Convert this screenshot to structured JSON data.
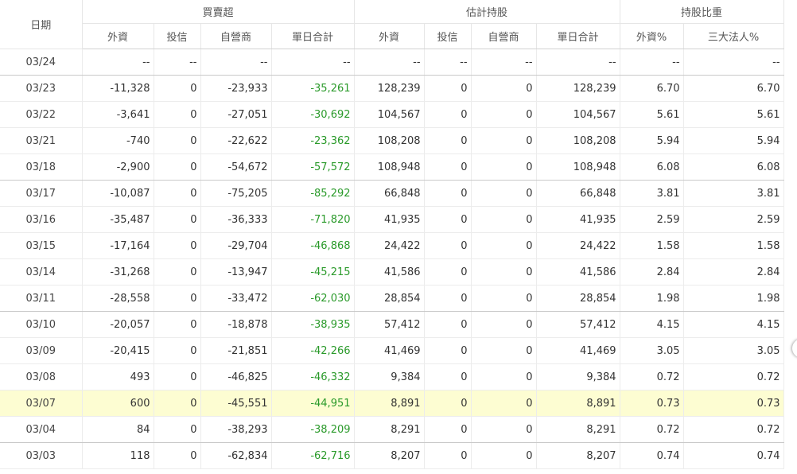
{
  "header": {
    "date_label": "日期",
    "group_trade": "買賣超",
    "group_holdings": "估計持股",
    "group_ratio": "持股比重",
    "col_foreign": "外資",
    "col_trust": "投信",
    "col_dealer": "自營商",
    "col_daily_total": "單日合計",
    "col_foreign_h": "外資",
    "col_trust_h": "投信",
    "col_dealer_h": "自營商",
    "col_daily_total_h": "單日合計",
    "col_foreign_pct": "外資%",
    "col_big3_pct": "三大法人%"
  },
  "colors": {
    "total_positive_green": "#2a9a2a",
    "highlight_row": "#fdfdd2"
  },
  "rows": [
    {
      "date": "03/24",
      "foreign": "--",
      "trust": "--",
      "dealer": "--",
      "total": "--",
      "h_foreign": "--",
      "h_trust": "--",
      "h_dealer": "--",
      "h_total": "--",
      "foreign_pct": "--",
      "big3_pct": "--"
    },
    {
      "date": "03/23",
      "foreign": "-11,328",
      "trust": "0",
      "dealer": "-23,933",
      "total": "-35,261",
      "h_foreign": "128,239",
      "h_trust": "0",
      "h_dealer": "0",
      "h_total": "128,239",
      "foreign_pct": "6.70",
      "big3_pct": "6.70"
    },
    {
      "date": "03/22",
      "foreign": "-3,641",
      "trust": "0",
      "dealer": "-27,051",
      "total": "-30,692",
      "h_foreign": "104,567",
      "h_trust": "0",
      "h_dealer": "0",
      "h_total": "104,567",
      "foreign_pct": "5.61",
      "big3_pct": "5.61"
    },
    {
      "date": "03/21",
      "foreign": "-740",
      "trust": "0",
      "dealer": "-22,622",
      "total": "-23,362",
      "h_foreign": "108,208",
      "h_trust": "0",
      "h_dealer": "0",
      "h_total": "108,208",
      "foreign_pct": "5.94",
      "big3_pct": "5.94"
    },
    {
      "date": "03/18",
      "foreign": "-2,900",
      "trust": "0",
      "dealer": "-54,672",
      "total": "-57,572",
      "h_foreign": "108,948",
      "h_trust": "0",
      "h_dealer": "0",
      "h_total": "108,948",
      "foreign_pct": "6.08",
      "big3_pct": "6.08"
    },
    {
      "date": "03/17",
      "foreign": "-10,087",
      "trust": "0",
      "dealer": "-75,205",
      "total": "-85,292",
      "h_foreign": "66,848",
      "h_trust": "0",
      "h_dealer": "0",
      "h_total": "66,848",
      "foreign_pct": "3.81",
      "big3_pct": "3.81"
    },
    {
      "date": "03/16",
      "foreign": "-35,487",
      "trust": "0",
      "dealer": "-36,333",
      "total": "-71,820",
      "h_foreign": "41,935",
      "h_trust": "0",
      "h_dealer": "0",
      "h_total": "41,935",
      "foreign_pct": "2.59",
      "big3_pct": "2.59"
    },
    {
      "date": "03/15",
      "foreign": "-17,164",
      "trust": "0",
      "dealer": "-29,704",
      "total": "-46,868",
      "h_foreign": "24,422",
      "h_trust": "0",
      "h_dealer": "0",
      "h_total": "24,422",
      "foreign_pct": "1.58",
      "big3_pct": "1.58"
    },
    {
      "date": "03/14",
      "foreign": "-31,268",
      "trust": "0",
      "dealer": "-13,947",
      "total": "-45,215",
      "h_foreign": "41,586",
      "h_trust": "0",
      "h_dealer": "0",
      "h_total": "41,586",
      "foreign_pct": "2.84",
      "big3_pct": "2.84"
    },
    {
      "date": "03/11",
      "foreign": "-28,558",
      "trust": "0",
      "dealer": "-33,472",
      "total": "-62,030",
      "h_foreign": "28,854",
      "h_trust": "0",
      "h_dealer": "0",
      "h_total": "28,854",
      "foreign_pct": "1.98",
      "big3_pct": "1.98"
    },
    {
      "date": "03/10",
      "foreign": "-20,057",
      "trust": "0",
      "dealer": "-18,878",
      "total": "-38,935",
      "h_foreign": "57,412",
      "h_trust": "0",
      "h_dealer": "0",
      "h_total": "57,412",
      "foreign_pct": "4.15",
      "big3_pct": "4.15"
    },
    {
      "date": "03/09",
      "foreign": "-20,415",
      "trust": "0",
      "dealer": "-21,851",
      "total": "-42,266",
      "h_foreign": "41,469",
      "h_trust": "0",
      "h_dealer": "0",
      "h_total": "41,469",
      "foreign_pct": "3.05",
      "big3_pct": "3.05"
    },
    {
      "date": "03/08",
      "foreign": "493",
      "trust": "0",
      "dealer": "-46,825",
      "total": "-46,332",
      "h_foreign": "9,384",
      "h_trust": "0",
      "h_dealer": "0",
      "h_total": "9,384",
      "foreign_pct": "0.72",
      "big3_pct": "0.72"
    },
    {
      "date": "03/07",
      "foreign": "600",
      "trust": "0",
      "dealer": "-45,551",
      "total": "-44,951",
      "h_foreign": "8,891",
      "h_trust": "0",
      "h_dealer": "0",
      "h_total": "8,891",
      "foreign_pct": "0.73",
      "big3_pct": "0.73"
    },
    {
      "date": "03/04",
      "foreign": "84",
      "trust": "0",
      "dealer": "-38,293",
      "total": "-38,209",
      "h_foreign": "8,291",
      "h_trust": "0",
      "h_dealer": "0",
      "h_total": "8,291",
      "foreign_pct": "0.72",
      "big3_pct": "0.72"
    },
    {
      "date": "03/03",
      "foreign": "118",
      "trust": "0",
      "dealer": "-62,834",
      "total": "-62,716",
      "h_foreign": "8,207",
      "h_trust": "0",
      "h_dealer": "0",
      "h_total": "8,207",
      "foreign_pct": "0.74",
      "big3_pct": "0.74"
    }
  ]
}
